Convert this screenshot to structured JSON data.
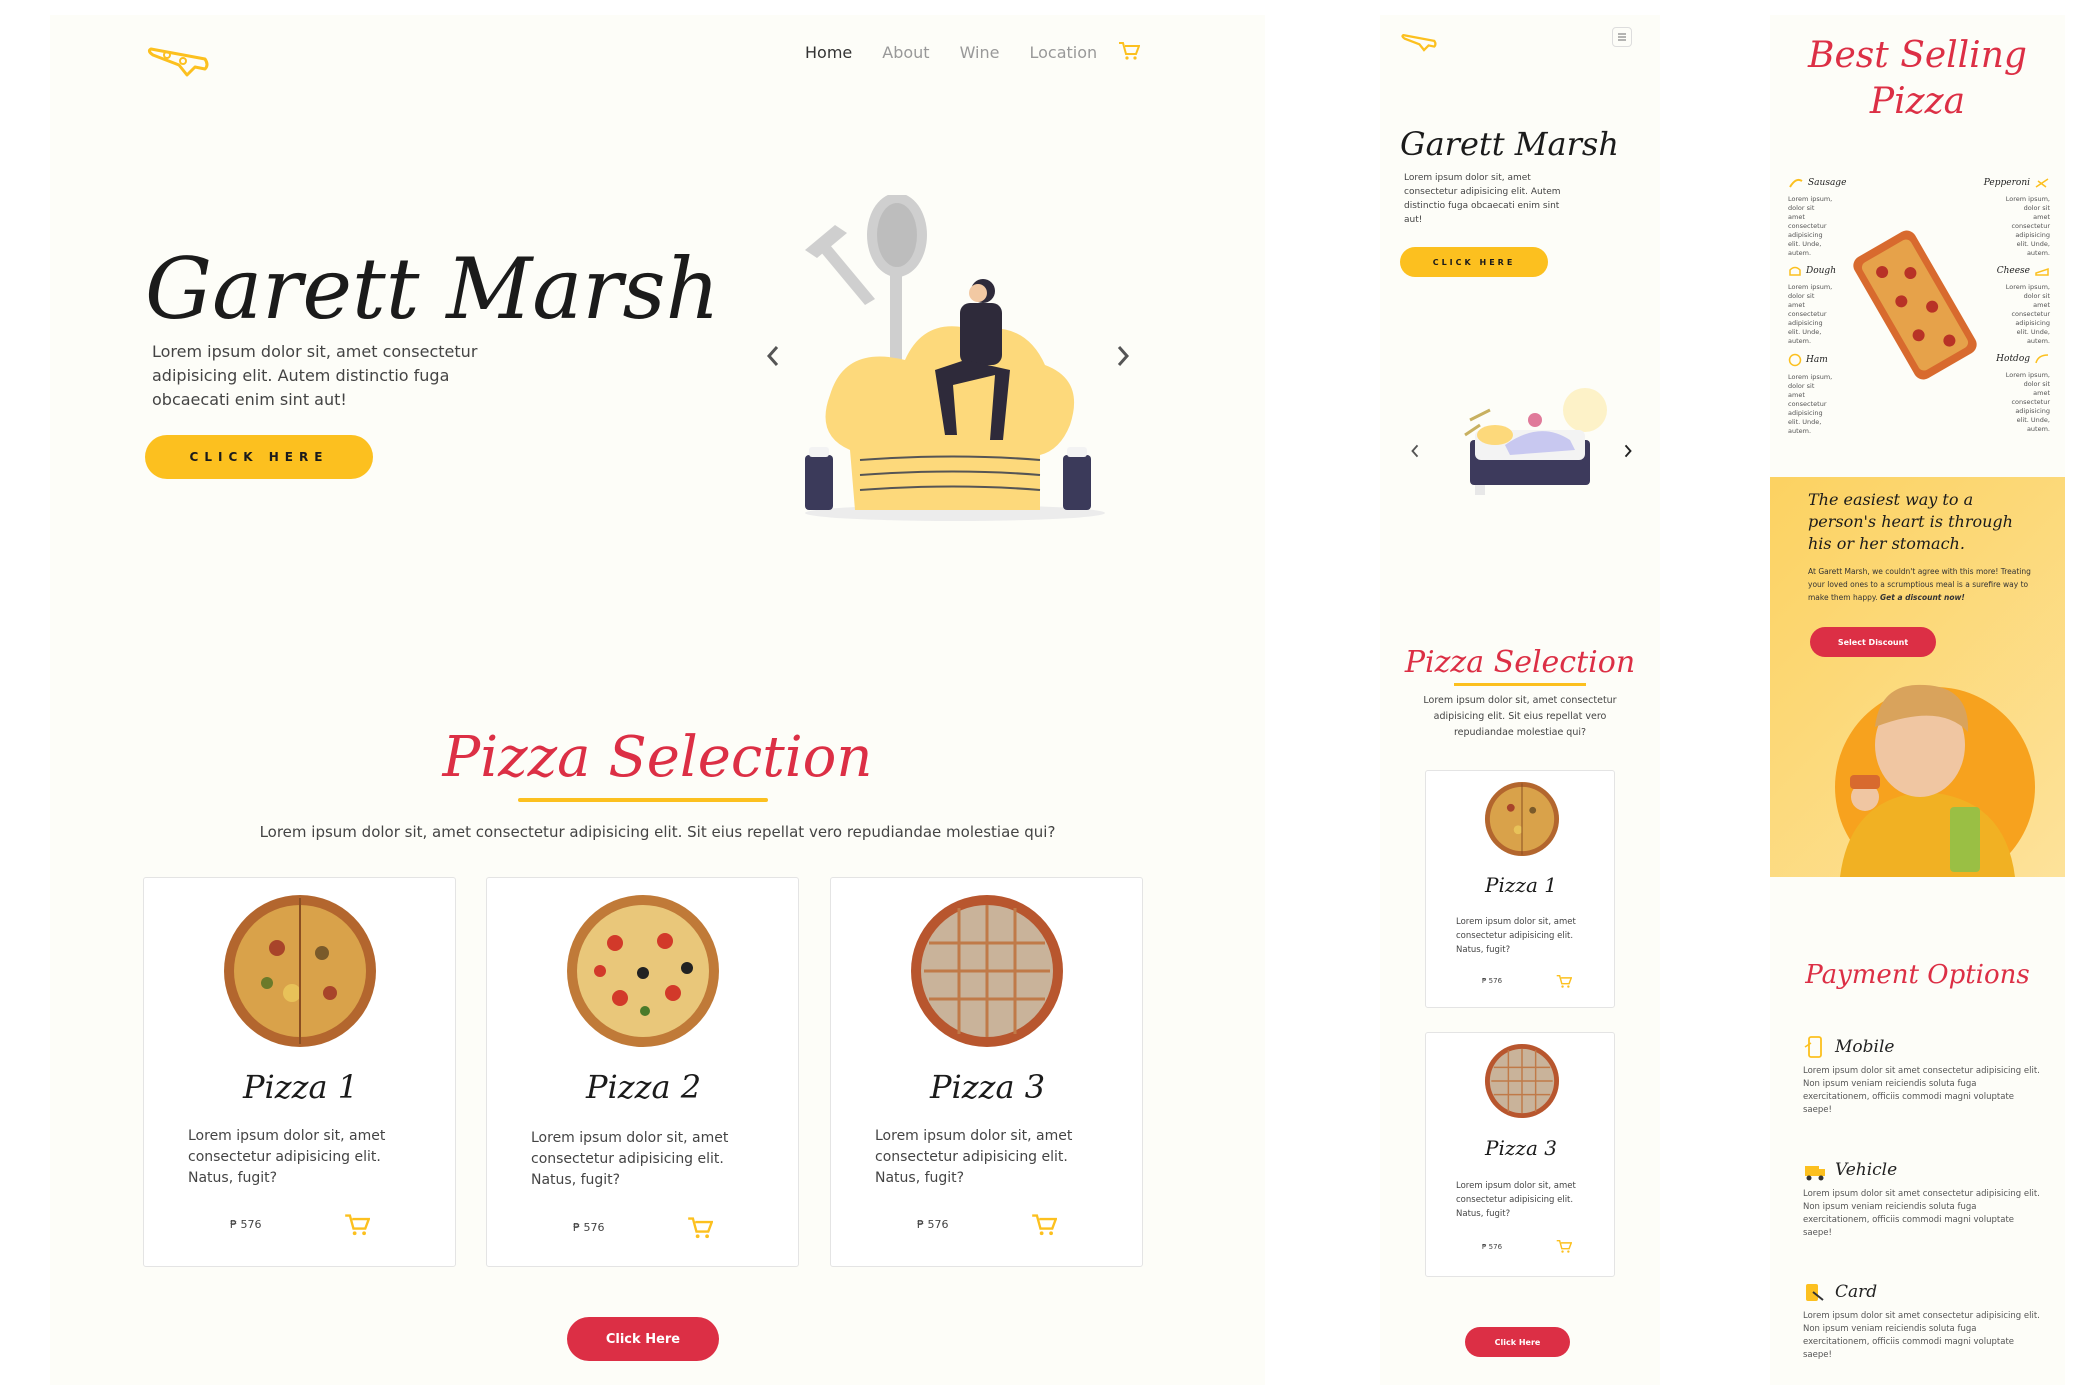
{
  "colors": {
    "accent_yellow": "#fcc01f",
    "accent_red": "#dc2f45",
    "dark": "#1b1b1b",
    "panel_bg": "#fdfdf8"
  },
  "desktop": {
    "nav": {
      "items": [
        "Home",
        "About",
        "Wine",
        "Location"
      ],
      "logo_icon": "pizza-slice-icon",
      "cart_icon": "cart-icon"
    },
    "hero": {
      "title": "Garett Marsh",
      "text": "Lorem ipsum dolor sit, amet consectetur adipisicing elit. Autem distinctio fuga obcaecati enim sint aut!",
      "button": "CLICK HERE"
    },
    "selection": {
      "title": "Pizza Selection",
      "subtitle": "Lorem ipsum dolor sit, amet consectetur adipisicing elit. Sit eius repellat vero repudiandae molestiae qui?",
      "cards": [
        {
          "name": "Pizza 1",
          "text": "Lorem ipsum dolor sit, amet consectetur adipisicing elit. Natus, fugit?",
          "price": "₱ 576"
        },
        {
          "name": "Pizza 2",
          "text": "Lorem ipsum dolor sit, amet consectetur adipisicing elit. Natus, fugit?",
          "price": "₱ 576"
        },
        {
          "name": "Pizza 3",
          "text": "Lorem ipsum dolor sit, amet consectetur adipisicing elit. Natus, fugit?",
          "price": "₱ 576"
        }
      ],
      "button": "Click Here"
    }
  },
  "mobile": {
    "hero": {
      "title": "Garett Marsh",
      "text": "Lorem ipsum dolor sit, amet consectetur adipisicing elit. Autem distinctio fuga obcaecati enim sint aut!",
      "button": "CLICK HERE"
    },
    "selection": {
      "title": "Pizza Selection",
      "subtitle": "Lorem ipsum dolor sit, amet consectetur adipisicing elit. Sit eius repellat vero repudiandae molestiae qui?",
      "cards": [
        {
          "name": "Pizza 1",
          "text": "Lorem ipsum dolor sit, amet consectetur adipisicing elit. Natus, fugit?",
          "price": "₱ 576"
        },
        {
          "name": "Pizza 3",
          "text": "Lorem ipsum dolor sit, amet consectetur adipisicing elit. Natus, fugit?",
          "price": "₱ 576"
        }
      ],
      "button": "Click Here"
    }
  },
  "right": {
    "best": {
      "title_line1": "Best Selling",
      "title_line2": "Pizza",
      "left_items": [
        {
          "name": "Sausage",
          "text": "Lorem ipsum, dolor sit amet consectetur adipisicing elit. Unde, autem."
        },
        {
          "name": "Dough",
          "text": "Lorem ipsum, dolor sit amet consectetur adipisicing elit. Unde, autem."
        },
        {
          "name": "Ham",
          "text": "Lorem ipsum, dolor sit amet consectetur adipisicing elit. Unde, autem."
        }
      ],
      "right_items": [
        {
          "name": "Pepperoni",
          "text": "Lorem ipsum, dolor sit amet consectetur adipisicing elit. Unde, autem."
        },
        {
          "name": "Cheese",
          "text": "Lorem ipsum, dolor sit amet consectetur adipisicing elit. Unde, autem."
        },
        {
          "name": "Hotdog",
          "text": "Lorem ipsum, dolor sit amet consectetur adipisicing elit. Unde, autem."
        }
      ]
    },
    "promo": {
      "quote": "The easiest way to a person's heart is through his or her stomach.",
      "text": "At Garett Marsh, we couldn't agree with this more! Treating your loved ones to a scrumptious meal is a surefire way to make them happy.",
      "text_bold": "Get a discount now!",
      "button": "Select Discount"
    },
    "payment": {
      "title": "Payment Options",
      "items": [
        {
          "name": "Mobile",
          "icon": "mobile-payment-icon",
          "text": "Lorem ipsum dolor sit amet consectetur adipisicing elit. Non ipsum veniam reiciendis soluta fuga exercitationem, officiis commodi magni voluptate saepe!"
        },
        {
          "name": "Vehicle",
          "icon": "vehicle-icon",
          "text": "Lorem ipsum dolor sit amet consectetur adipisicing elit. Non ipsum veniam reiciendis soluta fuga exercitationem, officiis commodi magni voluptate saepe!"
        },
        {
          "name": "Card",
          "icon": "card-icon",
          "text": "Lorem ipsum dolor sit amet consectetur adipisicing elit. Non ipsum veniam reiciendis soluta fuga exercitationem, officiis commodi magni voluptate saepe!"
        }
      ]
    }
  }
}
